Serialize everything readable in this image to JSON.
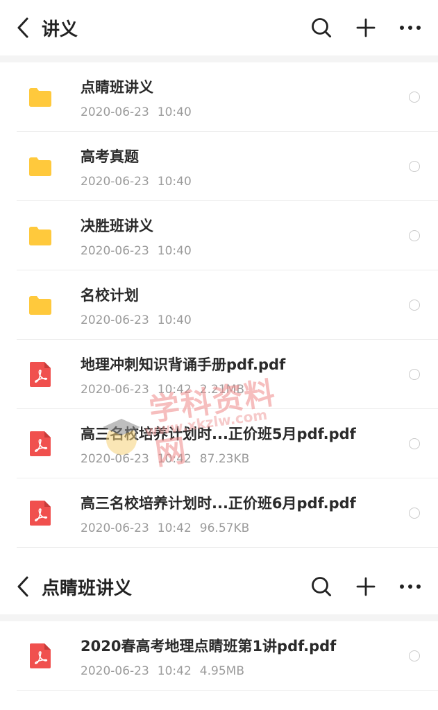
{
  "screen1": {
    "header": {
      "title": "讲义"
    },
    "items": [
      {
        "type": "folder",
        "name": "点睛班讲义",
        "date": "2020-06-23",
        "time": "10:40",
        "size": ""
      },
      {
        "type": "folder",
        "name": "高考真题",
        "date": "2020-06-23",
        "time": "10:40",
        "size": ""
      },
      {
        "type": "folder",
        "name": "决胜班讲义",
        "date": "2020-06-23",
        "time": "10:40",
        "size": ""
      },
      {
        "type": "folder",
        "name": "名校计划",
        "date": "2020-06-23",
        "time": "10:40",
        "size": ""
      },
      {
        "type": "pdf",
        "name": "地理冲刺知识背诵手册pdf.pdf",
        "date": "2020-06-23",
        "time": "10:42",
        "size": "2.21MB"
      },
      {
        "type": "pdf",
        "name": "高三名校培养计划时...正价班5月pdf.pdf",
        "date": "2020-06-23",
        "time": "10:42",
        "size": "87.23KB"
      },
      {
        "type": "pdf",
        "name": "高三名校培养计划时...正价班6月pdf.pdf",
        "date": "2020-06-23",
        "time": "10:42",
        "size": "96.57KB"
      }
    ],
    "watermark": {
      "text": "学科资料网",
      "url": "www.xkzlw.com"
    }
  },
  "screen2": {
    "header": {
      "title": "点睛班讲义"
    },
    "items": [
      {
        "type": "pdf",
        "name": "2020春高考地理点睛班第1讲pdf.pdf",
        "date": "2020-06-23",
        "time": "10:42",
        "size": "4.95MB"
      }
    ]
  },
  "icons": {
    "back": "chevron-left-icon",
    "search": "search-icon",
    "add": "plus-icon",
    "more": "more-horizontal-icon",
    "folder": "folder-icon",
    "pdf": "pdf-file-icon",
    "select": "radio-circle-icon"
  },
  "colors": {
    "folder": "#FFC93C",
    "pdf": "#F0504E",
    "meta_text": "#9B9B9B",
    "separator_band": "#F4F4F4"
  }
}
